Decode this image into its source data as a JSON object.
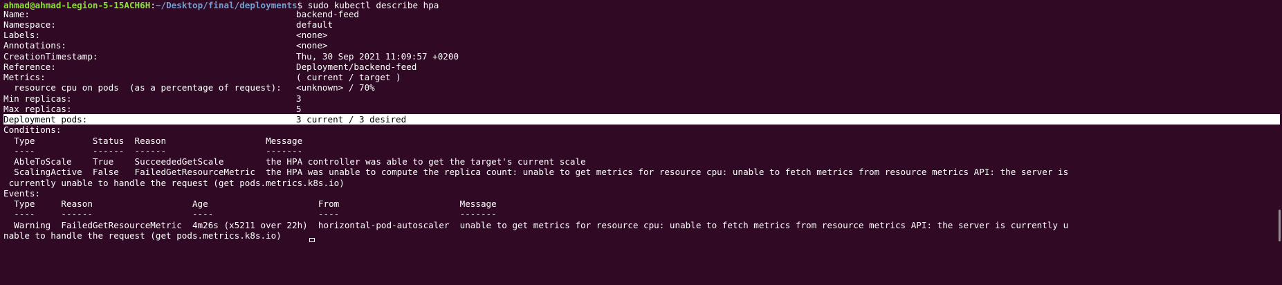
{
  "prompt": {
    "user_host": "ahmad@ahmad-Legion-5-15ACH6H",
    "sep": ":",
    "path": "~/Desktop/final/deployments",
    "symbol": "$",
    "command": " sudo kubectl describe hpa"
  },
  "fields": [
    {
      "label": "Name:",
      "value": "backend-feed"
    },
    {
      "label": "Namespace:",
      "value": "default"
    },
    {
      "label": "Labels:",
      "value": "<none>"
    },
    {
      "label": "Annotations:",
      "value": "<none>"
    },
    {
      "label": "CreationTimestamp:",
      "value": "Thu, 30 Sep 2021 11:09:57 +0200"
    },
    {
      "label": "Reference:",
      "value": "Deployment/backend-feed"
    },
    {
      "label": "Metrics:",
      "value": "( current / target )"
    },
    {
      "label": "  resource cpu on pods  (as a percentage of request):",
      "value": "<unknown> / 70%"
    },
    {
      "label": "Min replicas:",
      "value": "3"
    },
    {
      "label": "Max replicas:",
      "value": "5"
    },
    {
      "label": "Deployment pods:",
      "value": "3 current / 3 desired"
    }
  ],
  "conditions": {
    "label": "Conditions:",
    "header": "  Type           Status  Reason                   Message",
    "divider": "  ----           ------  ------                   -------",
    "rows": [
      "  AbleToScale    True    SucceededGetScale        the HPA controller was able to get the target's current scale",
      "  ScalingActive  False   FailedGetResourceMetric  the HPA was unable to compute the replica count: unable to get metrics for resource cpu: unable to fetch metrics from resource metrics API: the server is",
      " currently unable to handle the request (get pods.metrics.k8s.io)"
    ]
  },
  "events": {
    "label": "Events:",
    "header": "  Type     Reason                   Age                     From                       Message",
    "divider": "  ----     ------                   ----                    ----                       -------",
    "rows": [
      "  Warning  FailedGetResourceMetric  4m26s (x5211 over 22h)  horizontal-pod-autoscaler  unable to get metrics for resource cpu: unable to fetch metrics from resource metrics API: the server is currently u",
      "nable to handle the request (get pods.metrics.k8s.io)"
    ]
  },
  "colors": {
    "background": "#300a24",
    "prompt_user": "#8ae234",
    "prompt_path": "#729fcf",
    "text": "#ffffff"
  }
}
